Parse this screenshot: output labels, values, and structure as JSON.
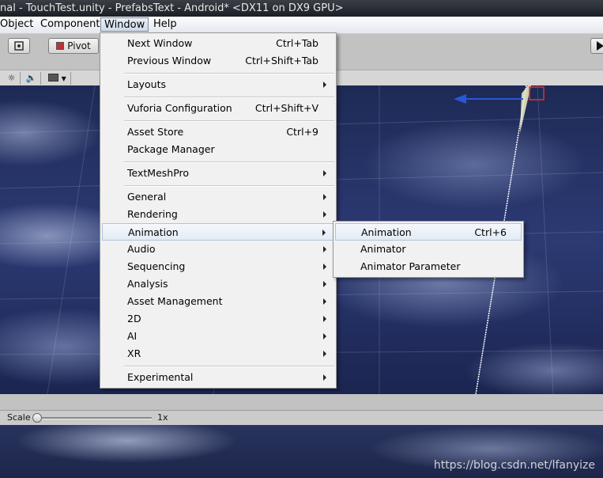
{
  "title_bar": {
    "text": "nal - TouchTest.unity - PrefabsText - Android* <DX11 on DX9 GPU>"
  },
  "menubar": [
    {
      "label": "Object"
    },
    {
      "label": "Component"
    },
    {
      "label": "Window"
    },
    {
      "label": "Help"
    }
  ],
  "toolbar": {
    "pivot_label": "Pivot"
  },
  "scale_bar": {
    "label": "Scale",
    "value": "1x"
  },
  "window_menu": [
    {
      "label": "Next Window",
      "shortcut": "Ctrl+Tab"
    },
    {
      "label": "Previous Window",
      "shortcut": "Ctrl+Shift+Tab"
    },
    {
      "label": "Layouts"
    },
    {
      "label": "Vuforia Configuration",
      "shortcut": "Ctrl+Shift+V"
    },
    {
      "label": "Asset Store",
      "shortcut": "Ctrl+9"
    },
    {
      "label": "Package Manager"
    },
    {
      "label": "TextMeshPro"
    },
    {
      "label": "General"
    },
    {
      "label": "Rendering"
    },
    {
      "label": "Animation"
    },
    {
      "label": "Audio"
    },
    {
      "label": "Sequencing"
    },
    {
      "label": "Analysis"
    },
    {
      "label": "Asset Management"
    },
    {
      "label": "2D"
    },
    {
      "label": "AI"
    },
    {
      "label": "XR"
    },
    {
      "label": "Experimental"
    }
  ],
  "animation_submenu": [
    {
      "label": "Animation",
      "shortcut": "Ctrl+6"
    },
    {
      "label": "Animator"
    },
    {
      "label": "Animator Parameter"
    }
  ],
  "watermark": "https://blog.csdn.net/lfanyize"
}
